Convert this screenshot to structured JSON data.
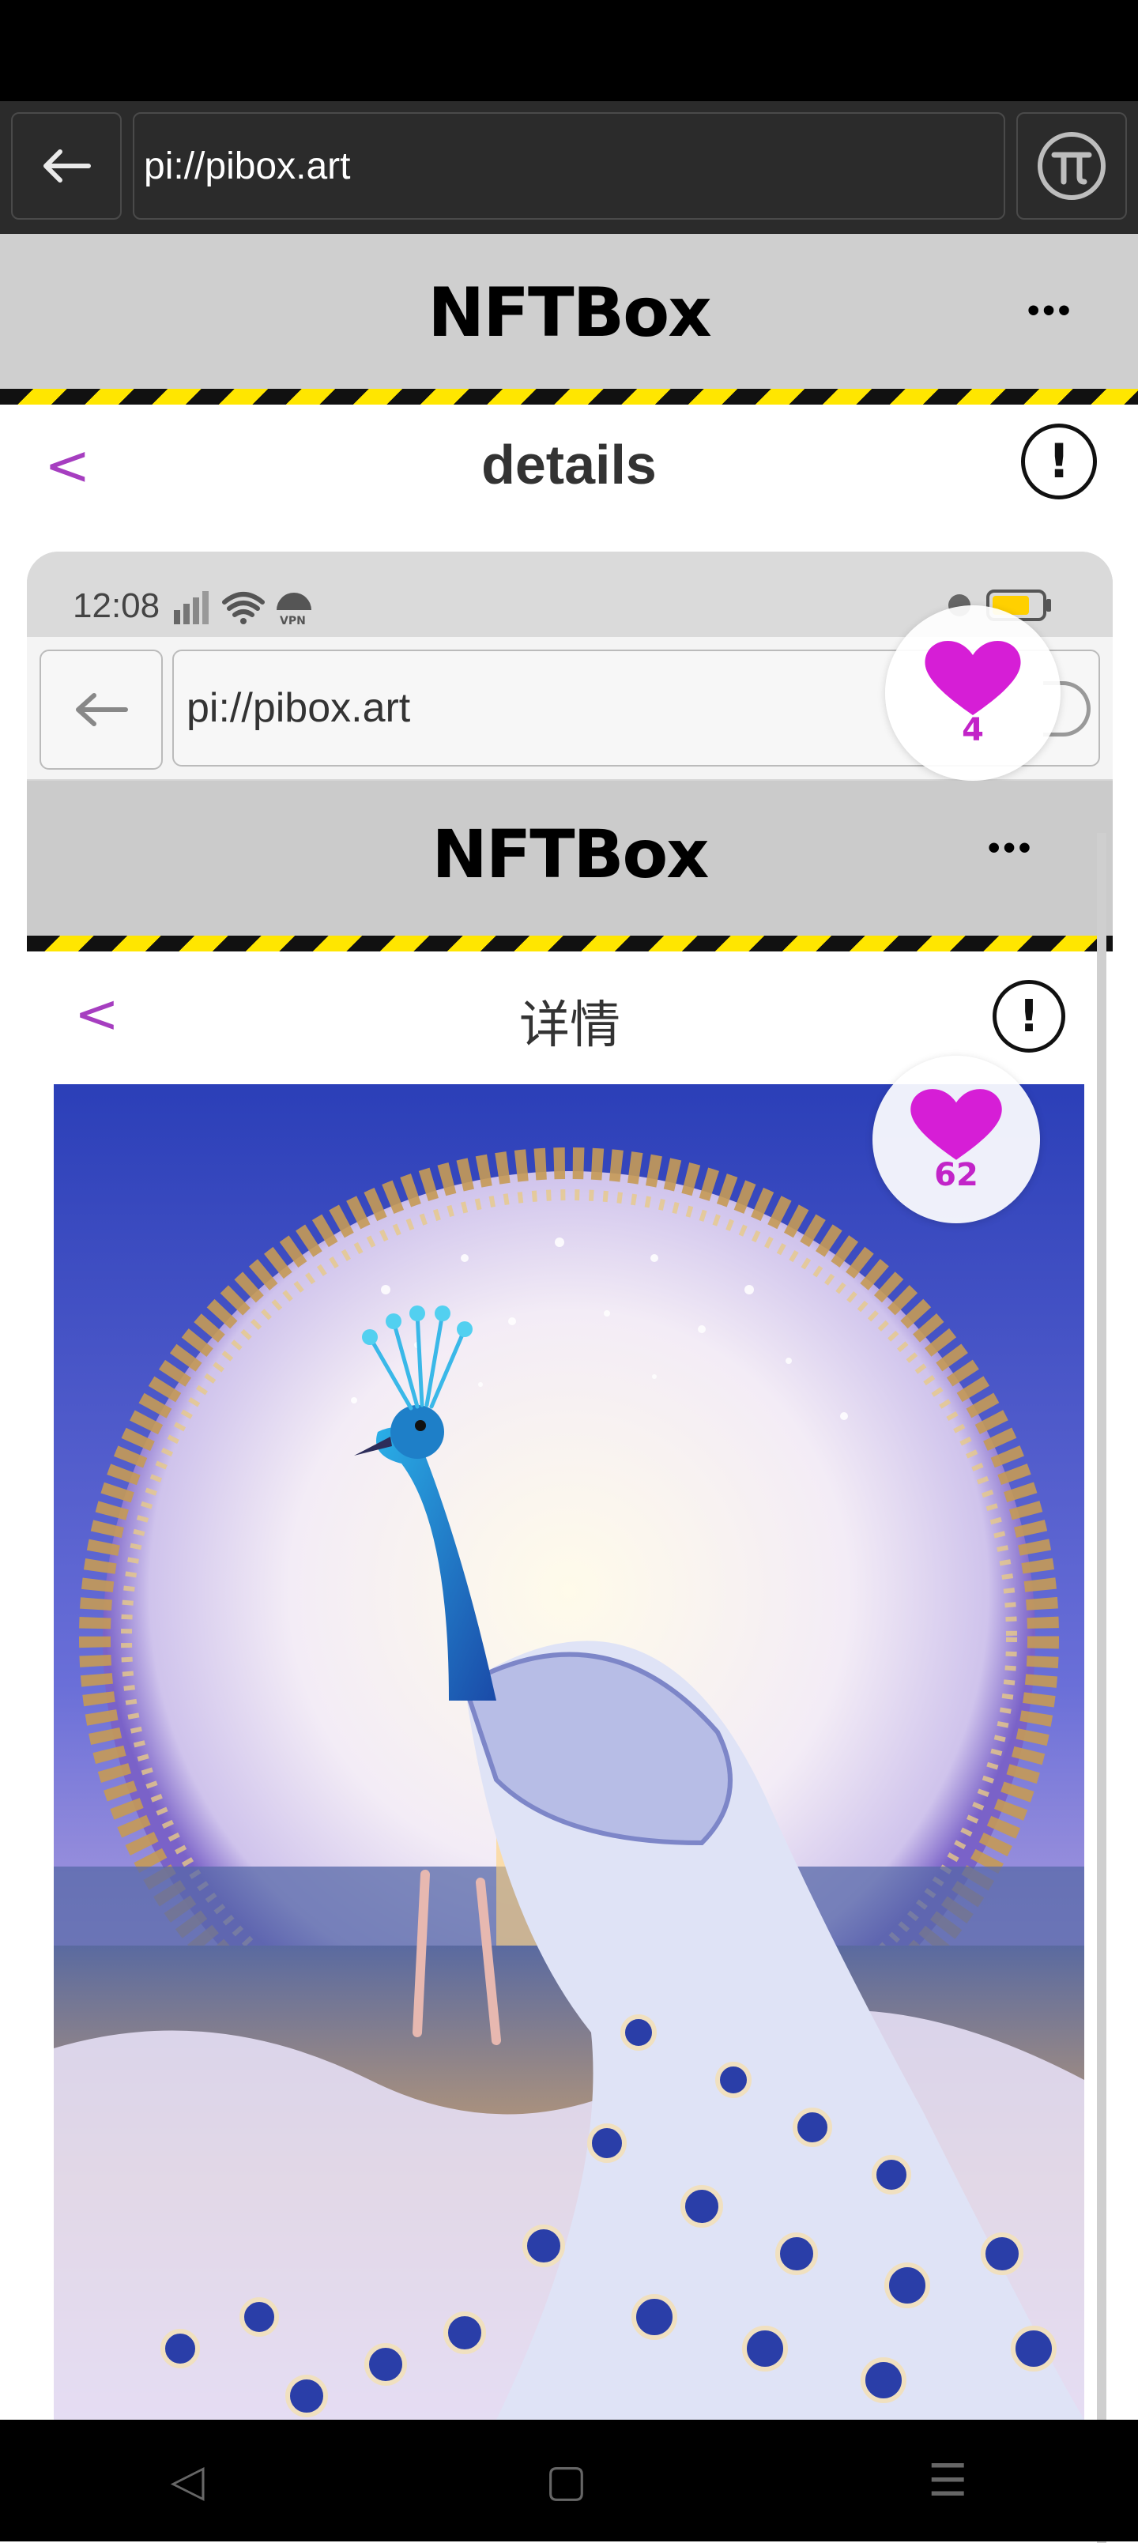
{
  "browser": {
    "url": "pi://pibox.art"
  },
  "header": {
    "title": "NFTBox",
    "more": "•••"
  },
  "page": {
    "title": "details",
    "back": "<",
    "info": "!"
  },
  "screenshot": {
    "status_time": "12:08",
    "url": "pi://pibox.art",
    "app_title": "NFTBox",
    "more": "•••",
    "page_title": "详情",
    "back": "<",
    "info": "!",
    "like_count": "4",
    "image_like_count": "62"
  },
  "navbar": {
    "back": "◁",
    "home": "▢",
    "menu": "☰"
  },
  "colors": {
    "accent": "#c224c8",
    "hazard_yellow": "#ffe600",
    "header_gray": "#cfcfcf"
  }
}
